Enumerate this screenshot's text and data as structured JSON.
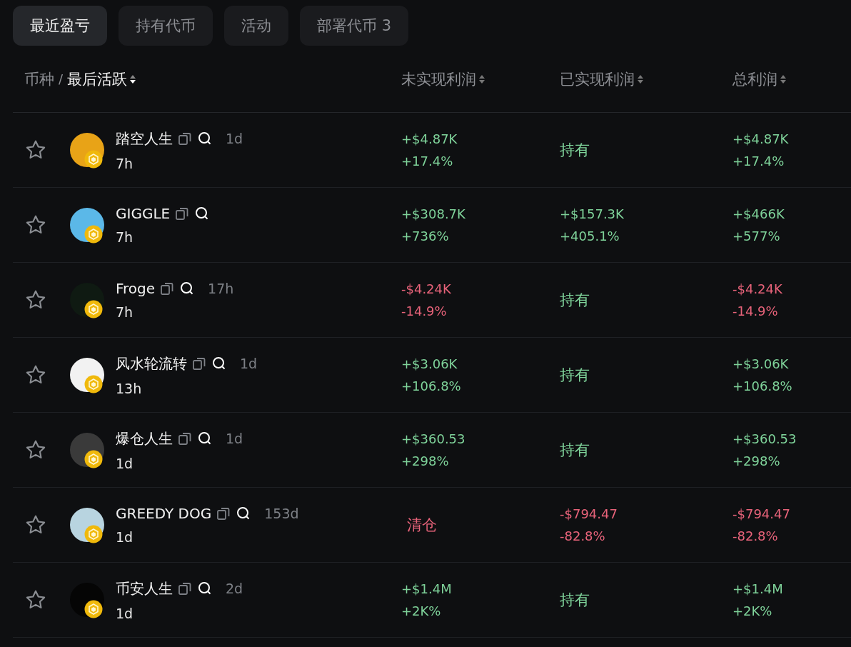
{
  "tabs": [
    {
      "label": "最近盈亏",
      "selected": true
    },
    {
      "label": "持有代币",
      "selected": false
    },
    {
      "label": "活动",
      "selected": false
    },
    {
      "label": "部署代币 3",
      "selected": false
    }
  ],
  "table": {
    "columns": {
      "token": "币种",
      "separator": "/",
      "last_active": "最后活跃",
      "unrealized": "未实现利润",
      "realized": "已实现利润",
      "total": "总利润"
    },
    "rows": [
      {
        "name": "踏空人生",
        "age": "1d",
        "last_active": "7h",
        "color": "#e8a317",
        "unrealized": {
          "kind": "pnl",
          "color": "#7fd39a",
          "value": "+$4.87K",
          "percent": "+17.4%"
        },
        "realized": {
          "kind": "status",
          "color": "#7fd39a",
          "value": "持有"
        },
        "total": {
          "kind": "pnl",
          "color": "#7fd39a",
          "value": "+$4.87K",
          "percent": "+17.4%"
        }
      },
      {
        "name": "GIGGLE",
        "age": "",
        "last_active": "7h",
        "color": "#5bb8e8",
        "unrealized": {
          "kind": "pnl",
          "color": "#7fd39a",
          "value": "+$308.7K",
          "percent": "+736%"
        },
        "realized": {
          "kind": "pnl",
          "color": "#7fd39a",
          "value": "+$157.3K",
          "percent": "+405.1%"
        },
        "total": {
          "kind": "pnl",
          "color": "#7fd39a",
          "value": "+$466K",
          "percent": "+577%"
        }
      },
      {
        "name": "Froge",
        "age": "17h",
        "last_active": "7h",
        "color": "#0f1a12",
        "unrealized": {
          "kind": "pnl",
          "color": "#e8637a",
          "value": "-$4.24K",
          "percent": "-14.9%"
        },
        "realized": {
          "kind": "status",
          "color": "#7fd39a",
          "value": "持有"
        },
        "total": {
          "kind": "pnl",
          "color": "#e8637a",
          "value": "-$4.24K",
          "percent": "-14.9%"
        }
      },
      {
        "name": "风水轮流转",
        "age": "1d",
        "last_active": "13h",
        "color": "#f2f2f2",
        "unrealized": {
          "kind": "pnl",
          "color": "#7fd39a",
          "value": "+$3.06K",
          "percent": "+106.8%"
        },
        "realized": {
          "kind": "status",
          "color": "#7fd39a",
          "value": "持有"
        },
        "total": {
          "kind": "pnl",
          "color": "#7fd39a",
          "value": "+$3.06K",
          "percent": "+106.8%"
        }
      },
      {
        "name": "爆仓人生",
        "age": "1d",
        "last_active": "1d",
        "color": "#3a3a3a",
        "unrealized": {
          "kind": "pnl",
          "color": "#7fd39a",
          "value": "+$360.53",
          "percent": "+298%"
        },
        "realized": {
          "kind": "status",
          "color": "#7fd39a",
          "value": "持有"
        },
        "total": {
          "kind": "pnl",
          "color": "#7fd39a",
          "value": "+$360.53",
          "percent": "+298%"
        }
      },
      {
        "name": "GREEDY DOG",
        "age": "153d",
        "last_active": "1d",
        "color": "#b8d4e0",
        "unrealized": {
          "kind": "status",
          "color": "#e8637a",
          "value": "清仓"
        },
        "realized": {
          "kind": "pnl",
          "color": "#e8637a",
          "value": "-$794.47",
          "percent": "-82.8%"
        },
        "total": {
          "kind": "pnl",
          "color": "#e8637a",
          "value": "-$794.47",
          "percent": "-82.8%"
        }
      },
      {
        "name": "币安人生",
        "age": "2d",
        "last_active": "1d",
        "color": "#050505",
        "unrealized": {
          "kind": "pnl",
          "color": "#7fd39a",
          "value": "+$1.4M",
          "percent": "+2K%"
        },
        "realized": {
          "kind": "status",
          "color": "#7fd39a",
          "value": "持有"
        },
        "total": {
          "kind": "pnl",
          "color": "#7fd39a",
          "value": "+$1.4M",
          "percent": "+2K%"
        }
      }
    ]
  }
}
